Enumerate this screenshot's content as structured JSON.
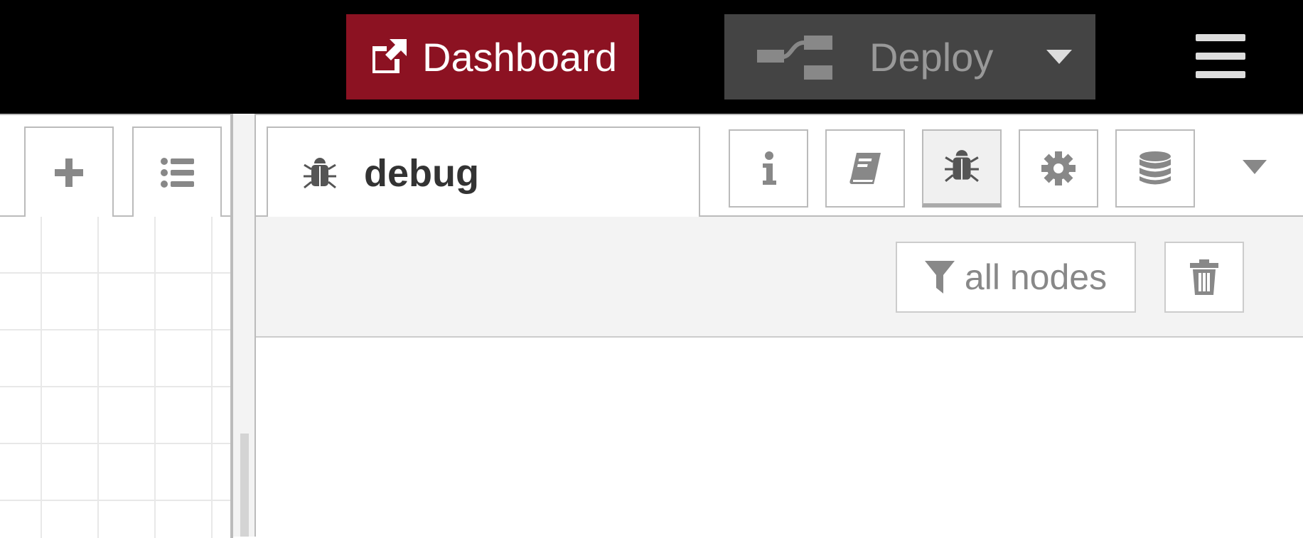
{
  "header": {
    "dashboard_label": "Dashboard",
    "deploy_label": "Deploy"
  },
  "workspace": {
    "add_icon": "plus-icon",
    "list_icon": "list-icon"
  },
  "sidebar": {
    "active_tab": {
      "label": "debug",
      "icon": "bug-icon"
    },
    "tab_buttons": [
      {
        "icon": "info-icon",
        "selected": false
      },
      {
        "icon": "book-icon",
        "selected": false
      },
      {
        "icon": "bug-icon",
        "selected": true
      },
      {
        "icon": "gear-icon",
        "selected": false
      },
      {
        "icon": "database-icon",
        "selected": false
      }
    ],
    "toolbar": {
      "filter_label": "all nodes",
      "filter_icon": "filter-icon",
      "clear_icon": "trash-icon"
    }
  },
  "colors": {
    "header_bg": "#000000",
    "dashboard_bg": "#8c1222",
    "deploy_bg": "#444444",
    "deploy_text": "#999999",
    "icon_gray": "#888888",
    "border": "#bbbbbb",
    "toolbar_bg": "#f3f3f3"
  }
}
